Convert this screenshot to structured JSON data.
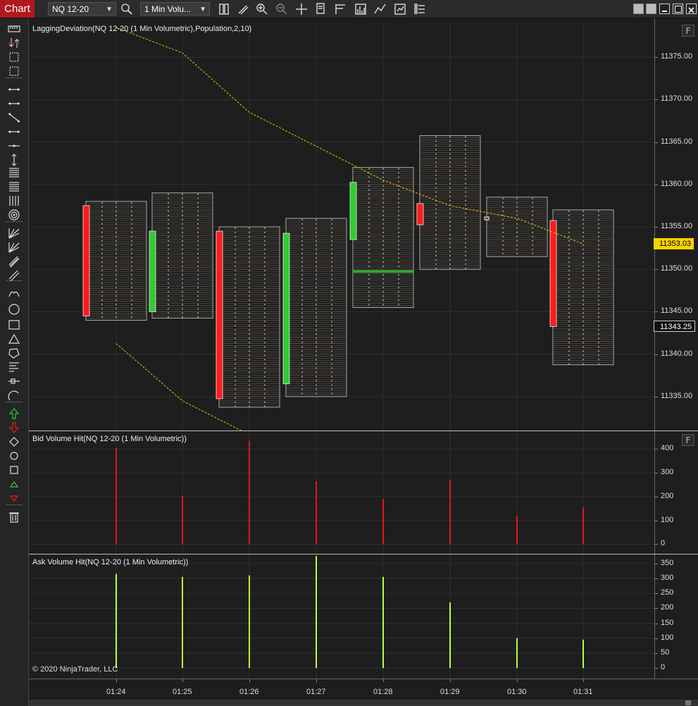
{
  "app": {
    "tab_label": "Chart",
    "instrument": "NQ 12-20",
    "interval": "1 Min Volu...",
    "copyright": "© 2020 NinjaTrader, LLC"
  },
  "colors": {
    "tab_red": "#b1191f",
    "bear_candle": "#ff1a1a",
    "bull_candle": "#2ecc2e",
    "band_line": "#e8c400",
    "bid_bar": "#e01818",
    "ask_bar": "#b8ff3c",
    "price_tag": "#f7d400"
  },
  "toolbar_icons": [
    "data-box-icon",
    "draw-pencil-icon",
    "zoom-in-icon",
    "zoom-out-icon",
    "crosshair-icon",
    "properties-icon",
    "templates-icon",
    "bar-type-icon",
    "strategies-icon",
    "snapshot-icon",
    "indicators-list-icon"
  ],
  "left_tools": [
    "ruler-icon",
    "risk-reward-icon",
    "region-icon",
    "region-highlight-icon",
    "line-icon",
    "ray-icon",
    "extended-line-icon",
    "arrow-line-icon",
    "horizontal-line-icon",
    "vertical-line-icon",
    "fibonacci-retracement-icon",
    "fibonacci-extension-icon",
    "fibonacci-time-icon",
    "fibonacci-circle-icon",
    "andrews-pitchfork-icon",
    "gann-fan-icon",
    "regression-channel-icon",
    "trend-channel-icon",
    "arc-icon",
    "ellipse-icon",
    "rectangle-icon",
    "triangle-icon",
    "polygon-icon",
    "text-icon",
    "path-icon",
    "time-cycles-icon",
    "arrow-up-icon",
    "arrow-down-icon",
    "diamond-icon",
    "dot-icon",
    "square-icon",
    "triangle-up-icon",
    "triangle-down-icon",
    "remove-drawings-icon"
  ],
  "panels": {
    "price": {
      "label": "LaggingDeviation(NQ 12-20 (1 Min Volumetric),Population,2,10)",
      "f_button": "F",
      "ticks": [
        "11375.00",
        "11370.00",
        "11365.00",
        "11360.00",
        "11355.00",
        "11350.00",
        "11345.00",
        "11340.00",
        "11335.00"
      ],
      "last_price": "11353.03",
      "current_price": "11343.25"
    },
    "bid": {
      "label": "Bid Volume Hit(NQ 12-20 (1 Min Volumetric))",
      "f_button": "F",
      "ticks": [
        "400",
        "300",
        "200",
        "100",
        "0"
      ]
    },
    "ask": {
      "label": "Ask Volume Hit(NQ 12-20 (1 Min Volumetric))",
      "ticks": [
        "350",
        "300",
        "250",
        "200",
        "150",
        "100",
        "50",
        "0"
      ]
    }
  },
  "time_labels": [
    "01:24",
    "01:25",
    "01:26",
    "01:27",
    "01:28",
    "01:29",
    "01:30",
    "01:31"
  ],
  "chart_data": [
    {
      "type": "candlestick",
      "title": "LaggingDeviation(NQ 12-20 (1 Min Volumetric),Population,2,10)",
      "categories": [
        "01:24",
        "01:25",
        "01:26",
        "01:27",
        "01:28",
        "01:29",
        "01:30",
        "01:31"
      ],
      "ylim": [
        11331,
        11379
      ],
      "candles": [
        {
          "time": "01:24",
          "open": 11357.5,
          "close": 11344.5,
          "high": 11358.0,
          "low": 11344.0,
          "dir": "down"
        },
        {
          "time": "01:25",
          "open": 11345.0,
          "close": 11354.5,
          "high": 11359.0,
          "low": 11344.25,
          "dir": "up"
        },
        {
          "time": "01:26",
          "open": 11354.5,
          "close": 11334.75,
          "high": 11355.0,
          "low": 11333.75,
          "dir": "down"
        },
        {
          "time": "01:27",
          "open": 11336.5,
          "close": 11354.25,
          "high": 11356.0,
          "low": 11335.0,
          "dir": "up"
        },
        {
          "time": "01:28",
          "open": 11353.5,
          "close": 11360.25,
          "high": 11362.0,
          "low": 11345.5,
          "dir": "up"
        },
        {
          "time": "01:29",
          "open": 11357.75,
          "close": 11355.25,
          "high": 11365.75,
          "low": 11350.0,
          "dir": "down"
        },
        {
          "time": "01:30",
          "open": 11356.25,
          "close": 11356.0,
          "high": 11358.5,
          "low": 11351.5,
          "dir": "flat"
        },
        {
          "time": "01:31",
          "open": 11355.75,
          "close": 11343.25,
          "high": 11357.0,
          "low": 11338.75,
          "dir": "down"
        }
      ],
      "poc": {
        "time": "01:28",
        "price": 11349.75
      },
      "upper_band": {
        "x": [
          "01:24",
          "01:25",
          "01:26",
          "01:27",
          "01:28",
          "01:29",
          "01:30",
          "01:31"
        ],
        "y": [
          11378.5,
          11375.5,
          11368.5,
          11364.5,
          11360.5,
          11357.5,
          11356.0,
          11353.0
        ]
      },
      "lower_band": {
        "x": [
          "01:24",
          "01:25",
          "01:26"
        ],
        "y": [
          11341.25,
          11334.5,
          11330.5
        ]
      }
    },
    {
      "type": "bar",
      "title": "Bid Volume Hit(NQ 12-20 (1 Min Volumetric))",
      "categories": [
        "01:24",
        "01:25",
        "01:26",
        "01:27",
        "01:28",
        "01:29",
        "01:30",
        "01:31"
      ],
      "values": [
        405,
        205,
        435,
        265,
        190,
        270,
        120,
        155
      ],
      "ylim": [
        -40,
        475
      ]
    },
    {
      "type": "bar",
      "title": "Ask Volume Hit(NQ 12-20 (1 Min Volumetric))",
      "categories": [
        "01:24",
        "01:25",
        "01:26",
        "01:27",
        "01:28",
        "01:29",
        "01:30",
        "01:31"
      ],
      "values": [
        315,
        305,
        310,
        375,
        305,
        220,
        100,
        95
      ],
      "ylim": [
        -35,
        380
      ]
    }
  ]
}
